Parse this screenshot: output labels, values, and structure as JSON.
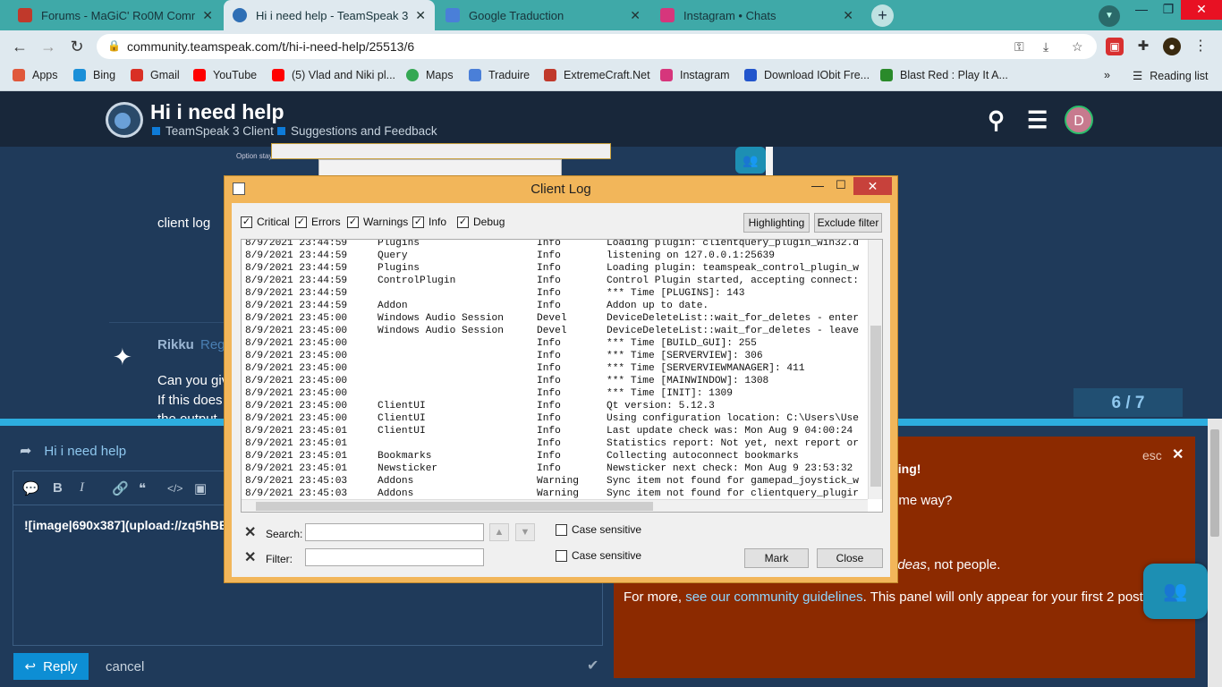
{
  "browser": {
    "tabs": [
      {
        "title": "Forums - MaGiC' Ro0M Communi",
        "active": false,
        "color": "#c0392b"
      },
      {
        "title": "Hi i need help - TeamSpeak 3 Cli",
        "active": true,
        "color": "#2f6fb5"
      },
      {
        "title": "Google Traduction",
        "active": false,
        "color": "#4a7fd8"
      },
      {
        "title": "Instagram • Chats",
        "active": false,
        "color": "#d6367c"
      }
    ],
    "tab_close": "✕",
    "new_tab": "+",
    "url": "community.teamspeak.com/t/hi-i-need-help/25513/6",
    "bookmarks": [
      {
        "label": "Apps",
        "color": "#e0583b"
      },
      {
        "label": "Bing",
        "color": "#1a8fd8"
      },
      {
        "label": "Gmail",
        "color": "#d93025"
      },
      {
        "label": "YouTube",
        "color": "#ff0000"
      },
      {
        "label": "(5) Vlad and Niki pl...",
        "color": "#ff0000"
      },
      {
        "label": "Maps",
        "color": "#34a853"
      },
      {
        "label": "Traduire",
        "color": "#4a7fd8"
      },
      {
        "label": "ExtremeCraft.Net",
        "color": "#c0392b"
      },
      {
        "label": "Instagram",
        "color": "#d6367c"
      },
      {
        "label": "Download IObit Fre...",
        "color": "#2255cc"
      },
      {
        "label": "Blast Red : Play It A...",
        "color": "#2a8a2a"
      }
    ],
    "more_bookmarks": "»",
    "reading_list": "Reading list"
  },
  "forum": {
    "topic_title": "Hi i need help",
    "categories": [
      "TeamSpeak 3 Client",
      "Suggestions and Feedback"
    ],
    "user_initial": "D",
    "post1_text": "client log",
    "post2": {
      "username": "Rikku",
      "role": "Reg",
      "line1": "Can you giv",
      "line2": "If this does",
      "line3": "the output"
    },
    "progress": "6 / 7"
  },
  "composer": {
    "reply_to": "Hi i need help",
    "editor_text": "![image|690x387](upload://zq5hBB",
    "reply_button": "Reply",
    "cancel": "cancel"
  },
  "tip_panel": {
    "esc": "esc",
    "heading": "buting!",
    "line1": "ome way?",
    "line2_em": "ideas",
    "line2_rest": ", not people.",
    "line3_pre": "For more, ",
    "line3_link": "see our community guidelines",
    "line3_post": ". This panel will only appear for your first 2 post"
  },
  "client_log": {
    "title": "Client Log",
    "filters": [
      "Critical",
      "Errors",
      "Warnings",
      "Info",
      "Debug"
    ],
    "highlighting": "Highlighting",
    "exclude_filter": "Exclude filter",
    "rows": [
      [
        "8/9/2021 23:44:59",
        "Plugins",
        "Info",
        "Loading plugin: clientquery_plugin_win32.d"
      ],
      [
        "8/9/2021 23:44:59",
        "Query",
        "Info",
        "listening on 127.0.0.1:25639"
      ],
      [
        "8/9/2021 23:44:59",
        "Plugins",
        "Info",
        "Loading plugin: teamspeak_control_plugin_w"
      ],
      [
        "8/9/2021 23:44:59",
        "ControlPlugin",
        "Info",
        "Control Plugin started, accepting connect:"
      ],
      [
        "8/9/2021 23:44:59",
        "",
        "Info",
        "*** Time [PLUGINS]: 143"
      ],
      [
        "8/9/2021 23:44:59",
        "Addon",
        "Info",
        "Addon up to date."
      ],
      [
        "8/9/2021 23:45:00",
        "Windows Audio Session",
        "Devel",
        "DeviceDeleteList::wait_for_deletes - enter"
      ],
      [
        "8/9/2021 23:45:00",
        "Windows Audio Session",
        "Devel",
        "DeviceDeleteList::wait_for_deletes - leave"
      ],
      [
        "8/9/2021 23:45:00",
        "",
        "Info",
        "*** Time [BUILD_GUI]: 255"
      ],
      [
        "8/9/2021 23:45:00",
        "",
        "Info",
        "*** Time [SERVERVIEW]: 306"
      ],
      [
        "8/9/2021 23:45:00",
        "",
        "Info",
        "*** Time [SERVERVIEWMANAGER]: 411"
      ],
      [
        "8/9/2021 23:45:00",
        "",
        "Info",
        "*** Time [MAINWINDOW]: 1308"
      ],
      [
        "8/9/2021 23:45:00",
        "",
        "Info",
        "*** Time [INIT]: 1309"
      ],
      [
        "8/9/2021 23:45:00",
        "ClientUI",
        "Info",
        "Qt version: 5.12.3"
      ],
      [
        "8/9/2021 23:45:00",
        "ClientUI",
        "Info",
        "Using configuration location: C:\\Users\\Use"
      ],
      [
        "8/9/2021 23:45:01",
        "ClientUI",
        "Info",
        "Last update check was: Mon Aug 9 04:00:24"
      ],
      [
        "8/9/2021 23:45:01",
        "",
        "Info",
        "Statistics report: Not yet, next report or"
      ],
      [
        "8/9/2021 23:45:01",
        "Bookmarks",
        "Info",
        "Collecting autoconnect bookmarks"
      ],
      [
        "8/9/2021 23:45:01",
        "Newsticker",
        "Info",
        "Newsticker next check: Mon Aug 9 23:53:32"
      ],
      [
        "8/9/2021 23:45:03",
        "Addons",
        "Warning",
        "Sync item not found for gamepad_joystick_w"
      ],
      [
        "8/9/2021 23:45:03",
        "Addons",
        "Warning",
        "Sync item not found for clientquery_plugir"
      ]
    ],
    "search_label": "Search:",
    "filter_label": "Filter:",
    "case_sensitive": "Case sensitive",
    "mark": "Mark",
    "close": "Close"
  }
}
